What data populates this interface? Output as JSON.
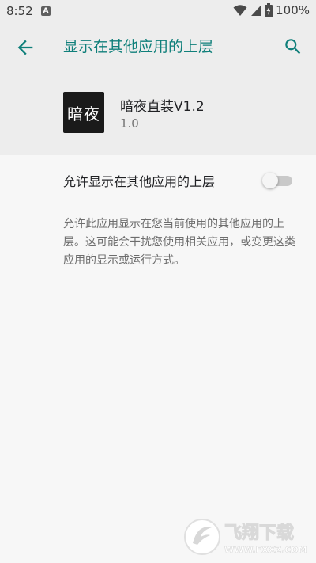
{
  "status_bar": {
    "time": "8:52",
    "notification_icon": "A",
    "battery_percent": "100%"
  },
  "toolbar": {
    "title": "显示在其他应用的上层",
    "back_icon": "arrow-left-icon",
    "search_icon": "search-icon"
  },
  "app": {
    "icon_text": "暗夜",
    "name": "暗夜直装V1.2",
    "version": "1.0"
  },
  "setting": {
    "label": "允许显示在其他应用的上层",
    "enabled": false
  },
  "description": "允许此应用显示在您当前使用的其他应用的上层。这可能会干扰您使用相关应用，或变更这类应用的显示或运行方式。",
  "watermark": {
    "text": "飞翔下载",
    "url": "WWW.FXXZ.COM"
  },
  "colors": {
    "accent": "#0f7f7a",
    "header_bg": "#ededed",
    "body_bg": "#f7f7f7"
  }
}
